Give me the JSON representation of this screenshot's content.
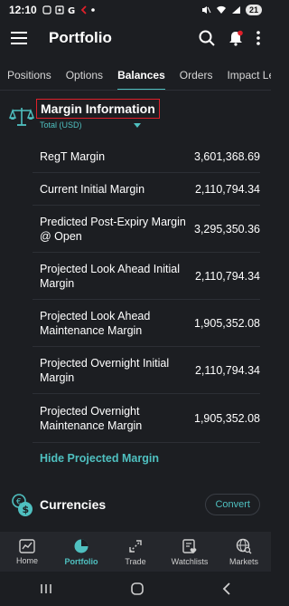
{
  "status_bar": {
    "time": "12:10",
    "battery": "21"
  },
  "app_bar": {
    "title": "Portfolio"
  },
  "tabs": [
    {
      "label": "Positions"
    },
    {
      "label": "Options"
    },
    {
      "label": "Balances",
      "active": true
    },
    {
      "label": "Orders"
    },
    {
      "label": "Impact Len"
    }
  ],
  "margin": {
    "title": "Margin Information",
    "subtitle": "Total (USD)",
    "rows": [
      {
        "label": "RegT Margin",
        "value": "3,601,368.69"
      },
      {
        "label": "Current Initial Margin",
        "value": "2,110,794.34"
      },
      {
        "label": "Predicted Post-Expiry Margin @ Open",
        "value": "3,295,350.36"
      },
      {
        "label": "Projected Look Ahead Initial Margin",
        "value": "2,110,794.34"
      },
      {
        "label": "Projected Look Ahead Maintenance Margin",
        "value": "1,905,352.08"
      },
      {
        "label": "Projected Overnight Initial Margin",
        "value": "2,110,794.34"
      },
      {
        "label": "Projected Overnight Maintenance Margin",
        "value": "1,905,352.08"
      }
    ],
    "hide_link": "Hide Projected Margin"
  },
  "currencies": {
    "title": "Currencies",
    "convert_label": "Convert"
  },
  "bottom_nav": [
    {
      "label": "Home",
      "icon": "home-chart-icon"
    },
    {
      "label": "Portfolio",
      "icon": "pie-chart-icon",
      "active": true
    },
    {
      "label": "Trade",
      "icon": "trade-arrows-icon"
    },
    {
      "label": "Watchlists",
      "icon": "watchlist-heart-icon"
    },
    {
      "label": "Markets",
      "icon": "globe-search-icon"
    }
  ],
  "colors": {
    "accent": "#4fc0c0",
    "background": "#1c1e22",
    "highlight_border": "#e0202a"
  }
}
